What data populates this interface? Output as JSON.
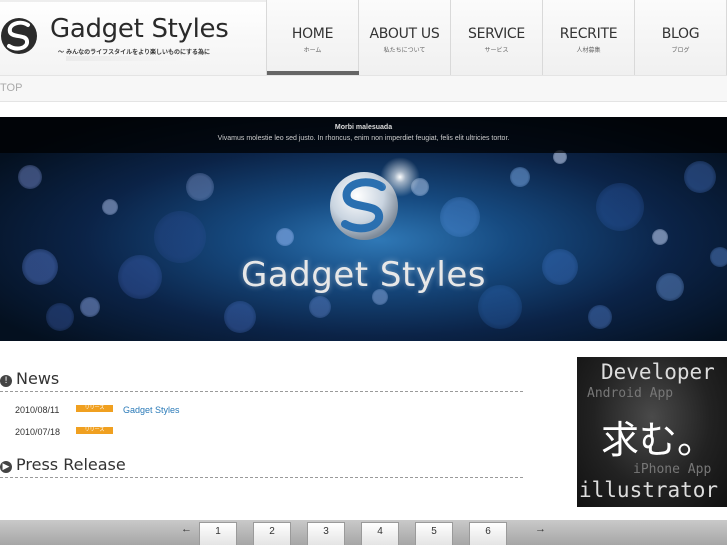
{
  "header": {
    "logo_title": "Gadget Styles",
    "logo_tagline": "〜 みんなのライフスタイルをより楽しいものにする為に",
    "nav": [
      {
        "en": "HOME",
        "jp": "ホーム",
        "active": true
      },
      {
        "en": "ABOUT US",
        "jp": "私たちについて",
        "active": false
      },
      {
        "en": "SERVICE",
        "jp": "サービス",
        "active": false
      },
      {
        "en": "RECRITE",
        "jp": "人材募集",
        "active": false
      },
      {
        "en": "BLOG",
        "jp": "ブログ",
        "active": false
      }
    ]
  },
  "breadcrumb": {
    "current": "TOP"
  },
  "banner": {
    "caption_title": "Morbi malesuada",
    "caption_text": "Vivamus molestie leo sed justo. In rhoncus, enim non imperdiet feugiat, felis elit ultricies tortor.",
    "title": "Gadget Styles"
  },
  "news": {
    "heading": "News",
    "items": [
      {
        "date": "2010/08/11",
        "badge": "リリース",
        "link": "Gadget Styles"
      },
      {
        "date": "2010/07/18",
        "badge": "リリース",
        "link": ""
      }
    ]
  },
  "press": {
    "heading": "Press Release"
  },
  "side_ad": {
    "line1": "Developer",
    "line2": "Android App",
    "main": "求む。",
    "line3": "iPhone App",
    "line4": "illustrator"
  },
  "pager": {
    "prev": "←",
    "next": "→",
    "pages": [
      "1",
      "2",
      "3",
      "4",
      "5",
      "6"
    ]
  },
  "colors": {
    "link": "#2a7ab8",
    "badge": "#f0a020",
    "banner_deep": "#0b2347"
  }
}
